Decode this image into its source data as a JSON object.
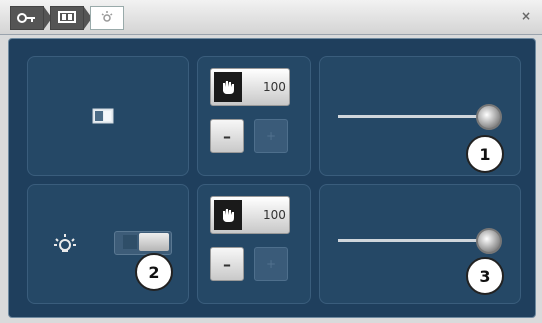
{
  "window": {
    "close_glyph": "×",
    "breadcrumb_icons": [
      "key-icon",
      "grid-icon",
      "light-icon"
    ]
  },
  "rows": [
    {
      "row_icon": "brightness-screen-icon",
      "value_label": "100",
      "minus_label": "–",
      "plus_label": "+",
      "slider_level": 1.0,
      "callout": "1"
    },
    {
      "row_icon": "lamp-icon",
      "value_label": "100",
      "minus_label": "–",
      "plus_label": "+",
      "slider_level": 1.0,
      "toggle_state": "on",
      "callout_toggle": "2",
      "callout": "3"
    }
  ],
  "colors": {
    "panel": "#1f3f5d",
    "cell": "#254866"
  }
}
